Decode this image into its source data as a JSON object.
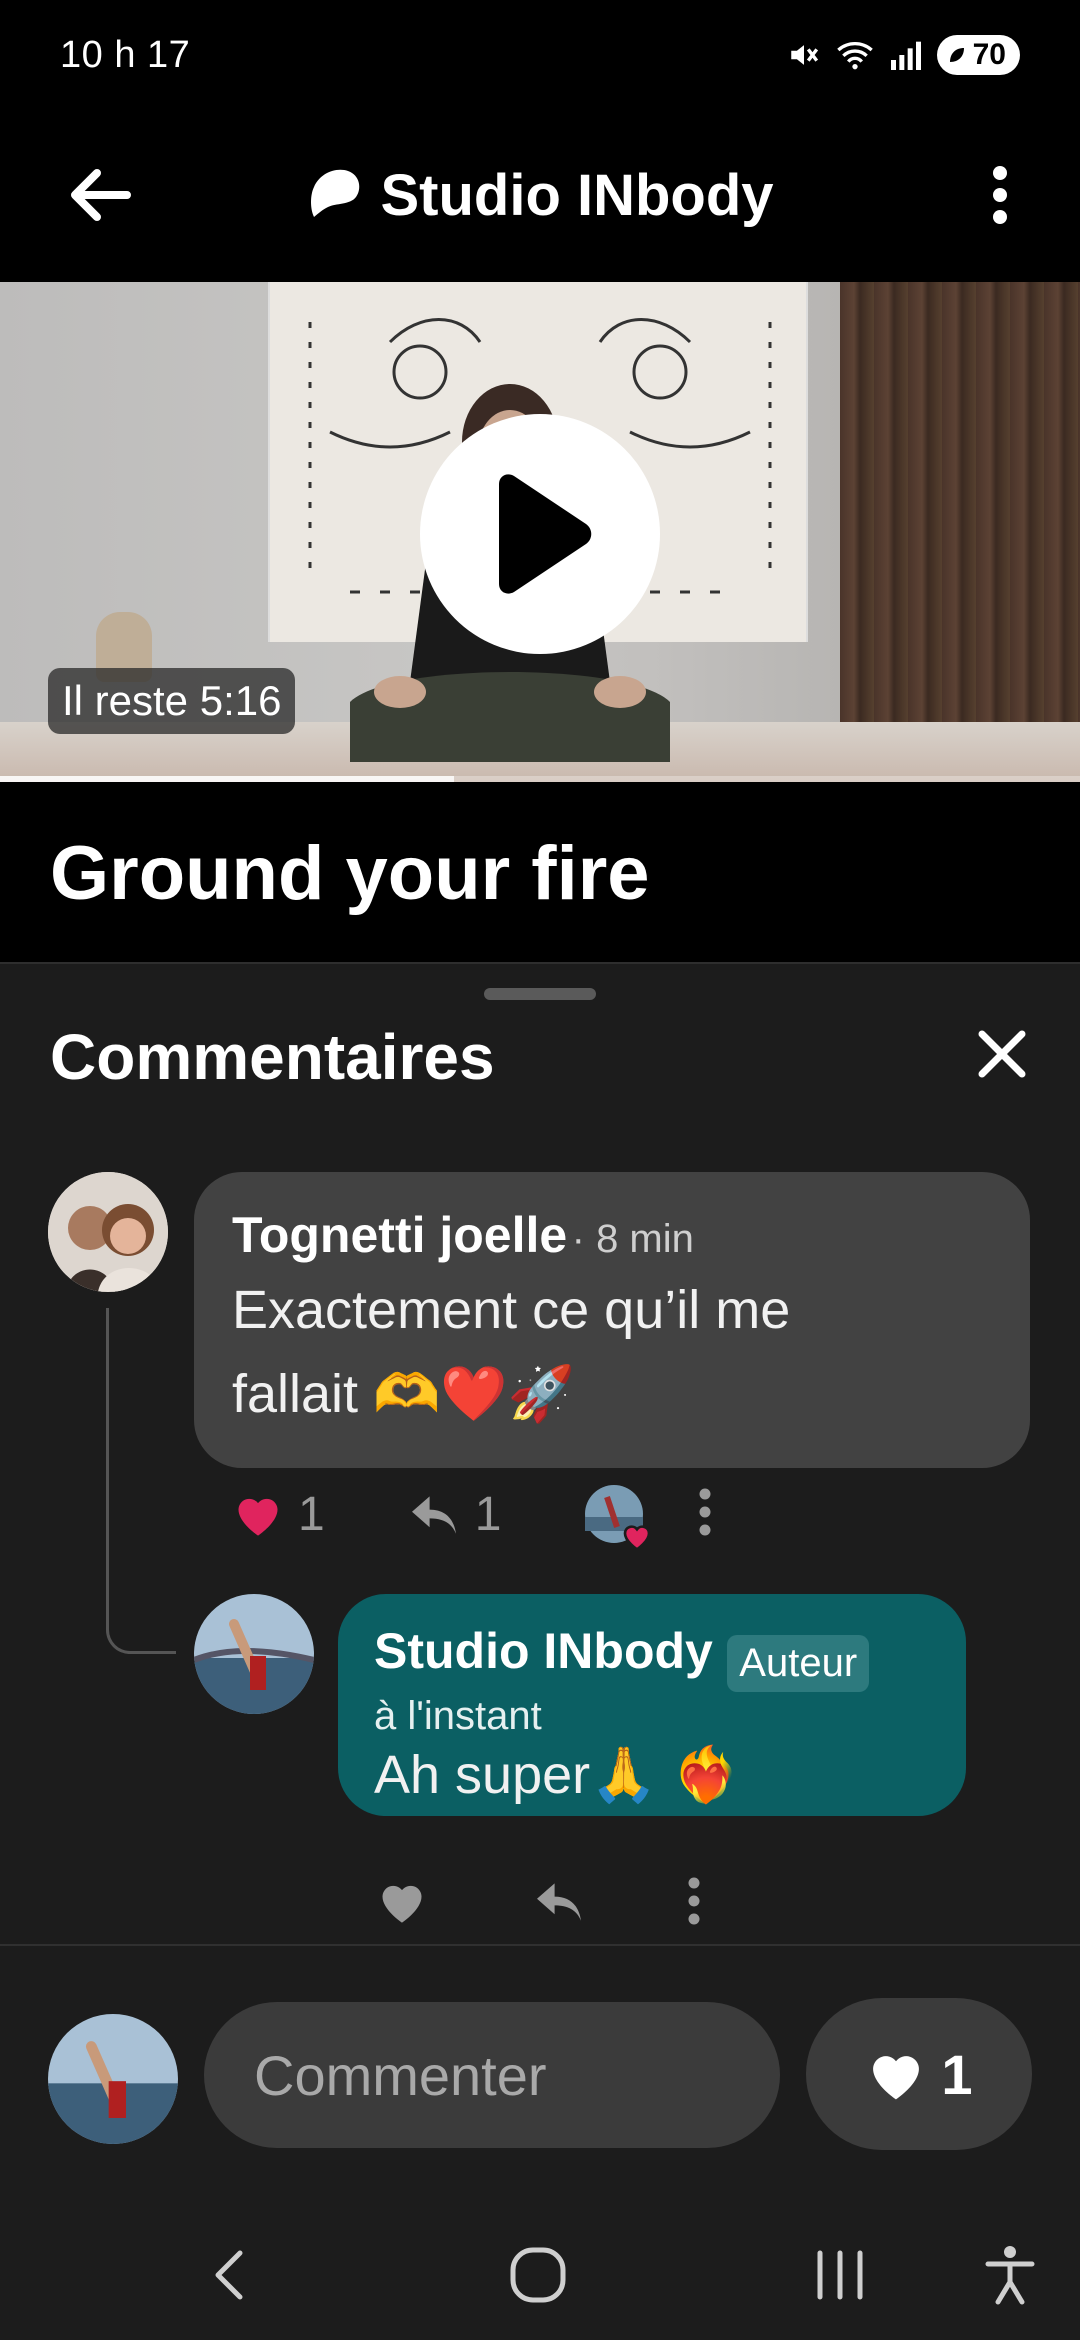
{
  "status": {
    "time": "10 h 17",
    "battery": "70"
  },
  "header": {
    "title": "Studio INbody"
  },
  "video": {
    "remaining": "Il reste 5:16",
    "progress": 0.42,
    "title": "Ground your fire"
  },
  "comments": {
    "title": "Commentaires",
    "items": [
      {
        "author": "Tognetti joelle",
        "time": "· 8 min",
        "text_line1": "Exactement ce qu’il me",
        "text_line2": "fallait 🫶❤️🚀",
        "likes": "1",
        "replies": "1"
      },
      {
        "author": "Studio INbody",
        "badge": "Auteur",
        "time": "à l'instant",
        "text": "Ah super🙏 ❤️‍🔥"
      }
    ]
  },
  "composer": {
    "placeholder": "Commenter",
    "like_count": "1"
  },
  "colors": {
    "background": "#000000",
    "sheet": "#1c1c1c",
    "bubble": "#424242",
    "author_bubble": "#0b5f63",
    "like_red": "#e0245e"
  }
}
